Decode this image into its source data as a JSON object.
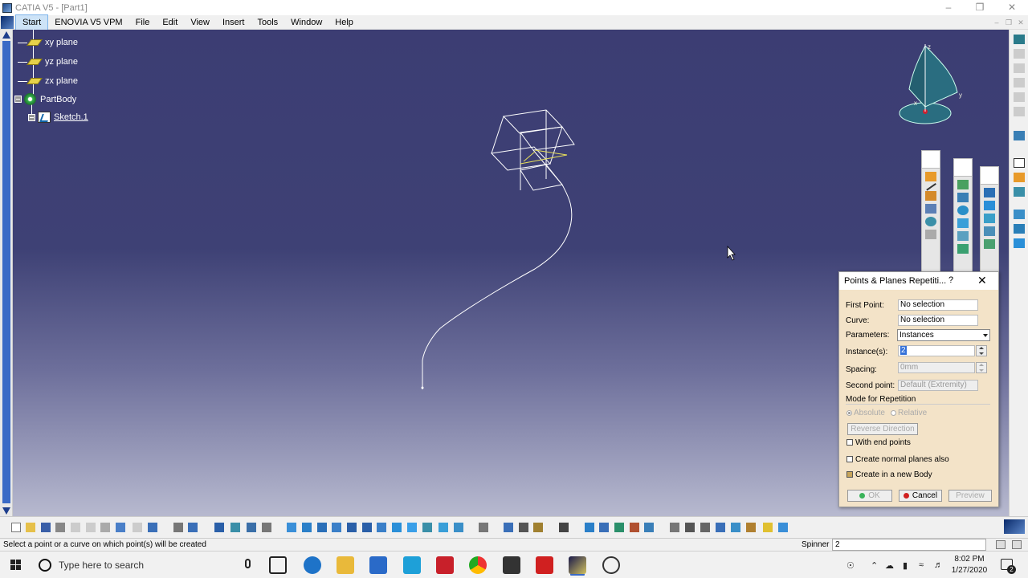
{
  "window": {
    "title": "CATIA V5 - [Part1]",
    "minimize": "–",
    "restore": "❒",
    "close": "✕"
  },
  "menu": {
    "items": [
      "Start",
      "ENOVIA V5 VPM",
      "File",
      "Edit",
      "View",
      "Insert",
      "Tools",
      "Window",
      "Help"
    ],
    "active": "Start"
  },
  "tree": {
    "nodes": [
      {
        "label": "xy plane",
        "icon": "plane-icon"
      },
      {
        "label": "yz plane",
        "icon": "plane-icon"
      },
      {
        "label": "zx plane",
        "icon": "plane-icon"
      },
      {
        "label": "PartBody",
        "icon": "body-icon"
      },
      {
        "label": "Sketch.1",
        "icon": "sketch-icon"
      }
    ]
  },
  "compass": {
    "x_label": "x",
    "y_label": "y",
    "z_label": "z"
  },
  "dialog": {
    "title": "Points & Planes Repetiti...",
    "help": "?",
    "close": "✕",
    "first_point_label": "First Point:",
    "first_point_value": "No selection",
    "curve_label": "Curve:",
    "curve_value": "No selection",
    "parameters_label": "Parameters:",
    "parameters_value": "Instances",
    "instances_label": "Instance(s):",
    "instances_value": "2",
    "spacing_label": "Spacing:",
    "spacing_value": "0mm",
    "second_point_label": "Second point:",
    "second_point_value": "Default (Extremity)",
    "mode_label": "Mode for Repetition",
    "mode_absolute": "Absolute",
    "mode_relative": "Relative",
    "reverse_direction": "Reverse Direction",
    "with_end_points": "With end points",
    "with_end_points_checked": false,
    "create_normal_planes": "Create normal planes also",
    "create_normal_planes_checked": false,
    "create_new_body": "Create in a new Body",
    "create_new_body_checked": true,
    "ok": "OK",
    "cancel": "Cancel",
    "preview": "Preview"
  },
  "status": {
    "message": "Select a point or a curve on which point(s) will be created",
    "spinner_label": "Spinner",
    "spinner_value": "2"
  },
  "taskbar": {
    "search_placeholder": "Type here to search",
    "time": "8:02 PM",
    "date": "1/27/2020",
    "notifications": "2"
  }
}
